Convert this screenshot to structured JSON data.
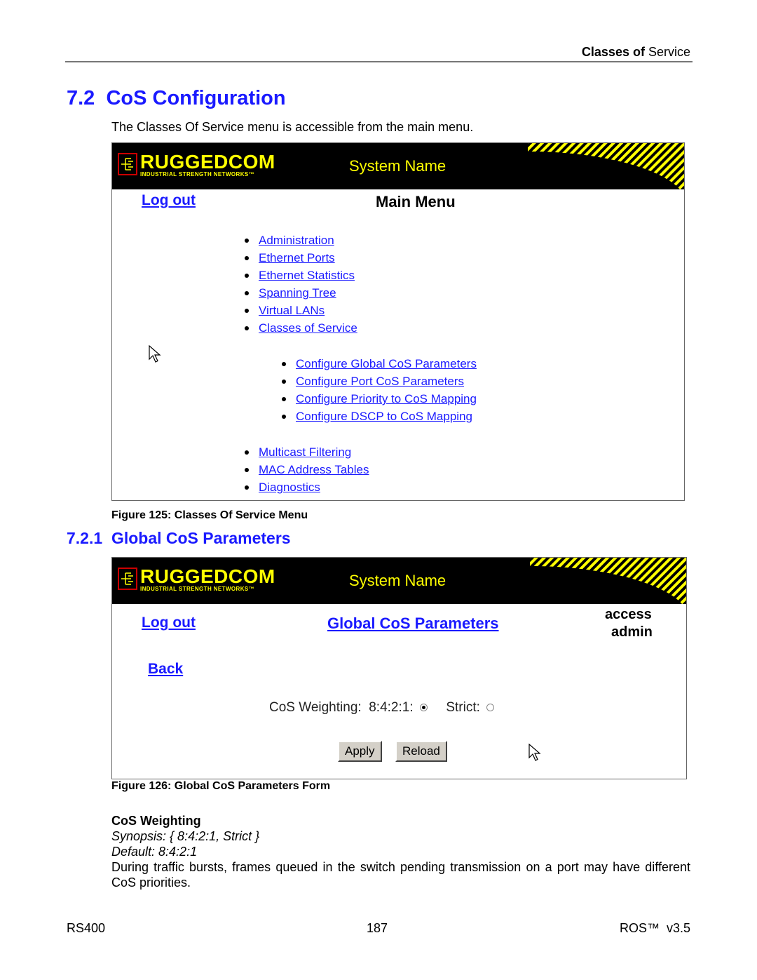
{
  "running_head": {
    "bold": "Classes of",
    "normal": "Service"
  },
  "section": {
    "number": "7.2",
    "title": "CoS Configuration"
  },
  "intro": "The Classes Of Service menu is accessible from the main menu.",
  "figure125": {
    "banner": {
      "logo_main": "RUGGEDCOM",
      "logo_sub": "INDUSTRIAL STRENGTH NETWORKS™",
      "system_name": "System Name"
    },
    "logout": "Log out",
    "title": "Main Menu",
    "menu_top": [
      "Administration",
      "Ethernet Ports",
      "Ethernet Statistics",
      "Spanning Tree",
      "Virtual LANs",
      "Classes of Service"
    ],
    "submenu": [
      "Configure Global CoS Parameters",
      "Configure Port CoS Parameters",
      "Configure Priority to CoS Mapping",
      "Configure DSCP to CoS Mapping"
    ],
    "menu_bottom": [
      "Multicast Filtering",
      "MAC Address Tables",
      "Diagnostics"
    ],
    "caption": "Figure 125: Classes Of Service Menu"
  },
  "subsection": {
    "number": "7.2.1",
    "title": "Global CoS Parameters"
  },
  "figure126": {
    "banner": {
      "logo_main": "RUGGEDCOM",
      "logo_sub": "INDUSTRIAL STRENGTH NETWORKS™",
      "system_name": "System Name"
    },
    "logout": "Log out",
    "title": "Global CoS Parameters",
    "access_label": "access",
    "access_value": "admin",
    "back": "Back",
    "field_label": "CoS Weighting:",
    "options": [
      {
        "label": "8:4:2:1:",
        "selected": true
      },
      {
        "label": "Strict:",
        "selected": false
      }
    ],
    "apply": "Apply",
    "reload": "Reload",
    "caption": "Figure 126: Global CoS Parameters Form"
  },
  "param": {
    "name": "CoS Weighting",
    "synopsis": "Synopsis: { 8:4:2:1, Strict }",
    "default": "Default: 8:4:2:1",
    "description": "During traffic bursts, frames queued in the switch pending transmission on a port may have different CoS priorities."
  },
  "footer": {
    "left": "RS400",
    "center": "187",
    "right": "ROS™  v3.5"
  }
}
